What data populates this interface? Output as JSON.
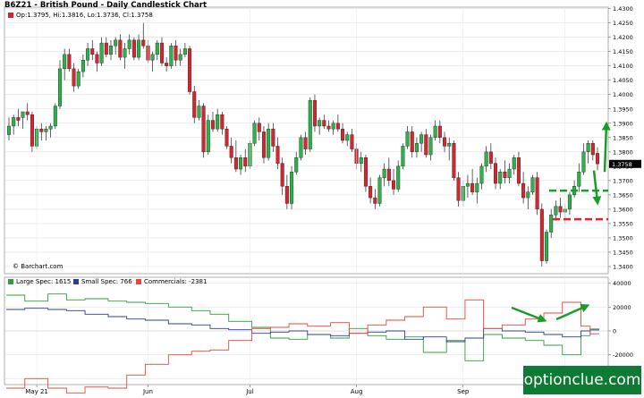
{
  "title": "B6Z21 - British Pound - Daily Candlestick Chart",
  "ohlc_label": "Op:1.3795, Hi:1.3816, Lo:1.3736, Cl:1.3758",
  "copyright": "© Barchart.com",
  "brand": "optionclue.com",
  "last_price_label": "1.3758",
  "colors": {
    "up": "#2bb34a",
    "down": "#d9232d",
    "large_spec": "#2e9d3a",
    "small_spec": "#2b3c9a",
    "commercials": "#e8473a",
    "arrow": "#1a9c2a",
    "dash_green": "#1a9c2a",
    "dash_red": "#d9232d",
    "brand_bg": "#0f7a33"
  },
  "cot_legend": [
    {
      "label": "Large Spec: 1615",
      "color": "#2e9d3a"
    },
    {
      "label": "Small Spec: 766",
      "color": "#2b3c9a"
    },
    {
      "label": "Commercials: -2381",
      "color": "#e8473a"
    }
  ],
  "chart_data": [
    {
      "type": "candlestick",
      "title": "B6Z21 - British Pound - Daily Candlestick Chart",
      "y_ticks": [
        1.34,
        1.345,
        1.35,
        1.355,
        1.36,
        1.365,
        1.37,
        1.375,
        1.38,
        1.385,
        1.39,
        1.395,
        1.4,
        1.405,
        1.41,
        1.415,
        1.42,
        1.425,
        1.43
      ],
      "ylim": [
        1.3375,
        1.4305
      ],
      "x_tick_labels": [
        {
          "label": "May 21",
          "index": 6
        },
        {
          "label": "Jun",
          "index": 30
        },
        {
          "label": "Jul",
          "index": 52
        },
        {
          "label": "Aug",
          "index": 75
        },
        {
          "label": "Sep",
          "index": 98
        },
        {
          "label": "O",
          "index": 120
        }
      ],
      "last_close": 1.3758,
      "candles": [
        [
          1.386,
          1.392,
          1.384,
          1.389
        ],
        [
          1.389,
          1.393,
          1.386,
          1.392
        ],
        [
          1.392,
          1.395,
          1.389,
          1.391
        ],
        [
          1.392,
          1.394,
          1.388,
          1.394
        ],
        [
          1.394,
          1.397,
          1.391,
          1.393
        ],
        [
          1.393,
          1.394,
          1.38,
          1.382
        ],
        [
          1.382,
          1.389,
          1.381,
          1.388
        ],
        [
          1.388,
          1.39,
          1.384,
          1.387
        ],
        [
          1.387,
          1.389,
          1.384,
          1.388
        ],
        [
          1.388,
          1.39,
          1.385,
          1.389
        ],
        [
          1.389,
          1.397,
          1.388,
          1.396
        ],
        [
          1.396,
          1.412,
          1.395,
          1.409
        ],
        [
          1.409,
          1.416,
          1.405,
          1.414
        ],
        [
          1.414,
          1.416,
          1.408,
          1.409
        ],
        [
          1.409,
          1.411,
          1.401,
          1.403
        ],
        [
          1.403,
          1.409,
          1.402,
          1.408
        ],
        [
          1.408,
          1.414,
          1.406,
          1.412
        ],
        [
          1.412,
          1.418,
          1.41,
          1.416
        ],
        [
          1.416,
          1.419,
          1.412,
          1.414
        ],
        [
          1.414,
          1.415,
          1.408,
          1.411
        ],
        [
          1.411,
          1.42,
          1.41,
          1.418
        ],
        [
          1.418,
          1.42,
          1.413,
          1.414
        ],
        [
          1.414,
          1.419,
          1.412,
          1.417
        ],
        [
          1.417,
          1.42,
          1.414,
          1.419
        ],
        [
          1.419,
          1.421,
          1.412,
          1.413
        ],
        [
          1.413,
          1.418,
          1.409,
          1.416
        ],
        [
          1.416,
          1.421,
          1.414,
          1.419
        ],
        [
          1.419,
          1.42,
          1.412,
          1.413
        ],
        [
          1.413,
          1.421,
          1.412,
          1.419
        ],
        [
          1.419,
          1.425,
          1.416,
          1.417
        ],
        [
          1.417,
          1.419,
          1.411,
          1.412
        ],
        [
          1.412,
          1.415,
          1.408,
          1.414
        ],
        [
          1.414,
          1.419,
          1.412,
          1.418
        ],
        [
          1.418,
          1.42,
          1.41,
          1.411
        ],
        [
          1.411,
          1.413,
          1.408,
          1.41
        ],
        [
          1.41,
          1.418,
          1.409,
          1.417
        ],
        [
          1.417,
          1.419,
          1.41,
          1.412
        ],
        [
          1.412,
          1.416,
          1.41,
          1.414
        ],
        [
          1.414,
          1.418,
          1.413,
          1.416
        ],
        [
          1.416,
          1.417,
          1.4,
          1.401
        ],
        [
          1.401,
          1.403,
          1.39,
          1.392
        ],
        [
          1.392,
          1.398,
          1.391,
          1.396
        ],
        [
          1.396,
          1.397,
          1.378,
          1.38
        ],
        [
          1.38,
          1.393,
          1.379,
          1.391
        ],
        [
          1.391,
          1.394,
          1.387,
          1.388
        ],
        [
          1.388,
          1.395,
          1.387,
          1.393
        ],
        [
          1.393,
          1.394,
          1.386,
          1.388
        ],
        [
          1.388,
          1.389,
          1.381,
          1.382
        ],
        [
          1.382,
          1.385,
          1.376,
          1.378
        ],
        [
          1.378,
          1.384,
          1.373,
          1.374
        ],
        [
          1.374,
          1.379,
          1.372,
          1.378
        ],
        [
          1.378,
          1.381,
          1.373,
          1.375
        ],
        [
          1.375,
          1.384,
          1.374,
          1.383
        ],
        [
          1.383,
          1.391,
          1.382,
          1.39
        ],
        [
          1.39,
          1.392,
          1.384,
          1.387
        ],
        [
          1.387,
          1.389,
          1.376,
          1.378
        ],
        [
          1.378,
          1.39,
          1.377,
          1.388
        ],
        [
          1.388,
          1.39,
          1.38,
          1.382
        ],
        [
          1.382,
          1.385,
          1.374,
          1.376
        ],
        [
          1.376,
          1.378,
          1.365,
          1.368
        ],
        [
          1.368,
          1.372,
          1.36,
          1.362
        ],
        [
          1.362,
          1.375,
          1.36,
          1.373
        ],
        [
          1.373,
          1.38,
          1.372,
          1.378
        ],
        [
          1.378,
          1.386,
          1.377,
          1.385
        ],
        [
          1.385,
          1.387,
          1.379,
          1.381
        ],
        [
          1.381,
          1.399,
          1.38,
          1.398
        ],
        [
          1.398,
          1.4,
          1.387,
          1.389
        ],
        [
          1.389,
          1.392,
          1.386,
          1.391
        ],
        [
          1.391,
          1.393,
          1.388,
          1.389
        ],
        [
          1.389,
          1.391,
          1.387,
          1.388
        ],
        [
          1.388,
          1.391,
          1.386,
          1.39
        ],
        [
          1.39,
          1.393,
          1.387,
          1.388
        ],
        [
          1.388,
          1.39,
          1.383,
          1.384
        ],
        [
          1.384,
          1.387,
          1.382,
          1.386
        ],
        [
          1.386,
          1.388,
          1.38,
          1.381
        ],
        [
          1.381,
          1.383,
          1.374,
          1.376
        ],
        [
          1.376,
          1.38,
          1.373,
          1.378
        ],
        [
          1.378,
          1.379,
          1.366,
          1.368
        ],
        [
          1.368,
          1.371,
          1.362,
          1.364
        ],
        [
          1.364,
          1.367,
          1.36,
          1.362
        ],
        [
          1.362,
          1.372,
          1.361,
          1.371
        ],
        [
          1.371,
          1.376,
          1.368,
          1.374
        ],
        [
          1.374,
          1.378,
          1.368,
          1.37
        ],
        [
          1.37,
          1.374,
          1.365,
          1.367
        ],
        [
          1.367,
          1.377,
          1.366,
          1.375
        ],
        [
          1.375,
          1.383,
          1.374,
          1.382
        ],
        [
          1.382,
          1.389,
          1.381,
          1.387
        ],
        [
          1.387,
          1.389,
          1.378,
          1.38
        ],
        [
          1.38,
          1.385,
          1.378,
          1.383
        ],
        [
          1.383,
          1.387,
          1.38,
          1.386
        ],
        [
          1.386,
          1.388,
          1.378,
          1.379
        ],
        [
          1.379,
          1.386,
          1.377,
          1.385
        ],
        [
          1.385,
          1.391,
          1.384,
          1.389
        ],
        [
          1.389,
          1.391,
          1.383,
          1.385
        ],
        [
          1.385,
          1.387,
          1.38,
          1.382
        ],
        [
          1.382,
          1.385,
          1.377,
          1.383
        ],
        [
          1.383,
          1.384,
          1.37,
          1.371
        ],
        [
          1.371,
          1.373,
          1.361,
          1.363
        ],
        [
          1.363,
          1.37,
          1.361,
          1.368
        ],
        [
          1.368,
          1.372,
          1.364,
          1.369
        ],
        [
          1.369,
          1.374,
          1.365,
          1.366
        ],
        [
          1.366,
          1.371,
          1.362,
          1.369
        ],
        [
          1.369,
          1.376,
          1.367,
          1.375
        ],
        [
          1.375,
          1.382,
          1.373,
          1.38
        ],
        [
          1.38,
          1.383,
          1.374,
          1.376
        ],
        [
          1.376,
          1.378,
          1.367,
          1.369
        ],
        [
          1.369,
          1.374,
          1.367,
          1.373
        ],
        [
          1.373,
          1.377,
          1.369,
          1.371
        ],
        [
          1.371,
          1.376,
          1.369,
          1.374
        ],
        [
          1.374,
          1.379,
          1.372,
          1.378
        ],
        [
          1.378,
          1.38,
          1.368,
          1.369
        ],
        [
          1.369,
          1.373,
          1.362,
          1.364
        ],
        [
          1.364,
          1.368,
          1.36,
          1.366
        ],
        [
          1.366,
          1.372,
          1.365,
          1.371
        ],
        [
          1.371,
          1.373,
          1.358,
          1.36
        ],
        [
          1.36,
          1.362,
          1.34,
          1.342
        ],
        [
          1.342,
          1.353,
          1.341,
          1.352
        ],
        [
          1.352,
          1.36,
          1.35,
          1.358
        ],
        [
          1.358,
          1.363,
          1.356,
          1.361
        ],
        [
          1.361,
          1.364,
          1.357,
          1.359
        ],
        [
          1.359,
          1.362,
          1.355,
          1.36
        ],
        [
          1.36,
          1.366,
          1.358,
          1.365
        ],
        [
          1.365,
          1.37,
          1.364,
          1.368
        ],
        [
          1.368,
          1.376,
          1.366,
          1.373
        ],
        [
          1.373,
          1.383,
          1.372,
          1.38
        ],
        [
          1.38,
          1.384,
          1.376,
          1.383
        ],
        [
          1.383,
          1.384,
          1.377,
          1.379
        ],
        [
          1.3795,
          1.3816,
          1.3736,
          1.3758
        ]
      ]
    },
    {
      "type": "line",
      "title": "COT",
      "y_ticks": [
        -40000,
        -20000,
        0,
        20000,
        40000
      ],
      "y_tick_labels": [
        "-40000",
        "-20000",
        "0",
        "20000",
        "40000"
      ],
      "ylim": [
        -45000,
        45000
      ],
      "series": [
        {
          "name": "Large Spec: 1615",
          "color": "#2e9d3a",
          "steps": [
            [
              0,
              30000
            ],
            [
              4,
              25000
            ],
            [
              9,
              31000
            ],
            [
              13,
              26000
            ],
            [
              17,
              27000
            ],
            [
              22,
              25000
            ],
            [
              26,
              24000
            ],
            [
              30,
              23000
            ],
            [
              35,
              20000
            ],
            [
              40,
              17000
            ],
            [
              44,
              14000
            ],
            [
              48,
              8000
            ],
            [
              53,
              3000
            ],
            [
              57,
              -6000
            ],
            [
              61,
              -7000
            ],
            [
              65,
              -3000
            ],
            [
              70,
              -6000
            ],
            [
              74,
              2000
            ],
            [
              78,
              -4000
            ],
            [
              82,
              -7000
            ],
            [
              86,
              -5000
            ],
            [
              90,
              -18000
            ],
            [
              95,
              -8000
            ],
            [
              99,
              -25000
            ],
            [
              103,
              -3000
            ],
            [
              107,
              -6000
            ],
            [
              112,
              -8000
            ],
            [
              116,
              -12000
            ],
            [
              120,
              -20000
            ],
            [
              124,
              -4000
            ],
            [
              126,
              1615
            ]
          ]
        },
        {
          "name": "Small Spec: 766",
          "color": "#2b3c9a",
          "steps": [
            [
              0,
              18000
            ],
            [
              4,
              19000
            ],
            [
              9,
              18000
            ],
            [
              13,
              17000
            ],
            [
              17,
              14000
            ],
            [
              22,
              12000
            ],
            [
              26,
              10000
            ],
            [
              30,
              9000
            ],
            [
              35,
              6000
            ],
            [
              40,
              5000
            ],
            [
              44,
              2000
            ],
            [
              48,
              1000
            ],
            [
              53,
              -2000
            ],
            [
              57,
              -1000
            ],
            [
              61,
              0
            ],
            [
              65,
              -3000
            ],
            [
              70,
              -4000
            ],
            [
              74,
              -2000
            ],
            [
              78,
              -1000
            ],
            [
              82,
              0
            ],
            [
              86,
              -7000
            ],
            [
              90,
              -5000
            ],
            [
              95,
              -9000
            ],
            [
              99,
              -6000
            ],
            [
              103,
              2000
            ],
            [
              107,
              0
            ],
            [
              112,
              -1000
            ],
            [
              116,
              -3000
            ],
            [
              120,
              -5000
            ],
            [
              124,
              0
            ],
            [
              126,
              766
            ]
          ]
        },
        {
          "name": "Commercials: -2381",
          "color": "#e8473a",
          "steps": [
            [
              0,
              -48000
            ],
            [
              4,
              -40000
            ],
            [
              9,
              -48000
            ],
            [
              13,
              -52000
            ],
            [
              17,
              -47000
            ],
            [
              22,
              -48000
            ],
            [
              26,
              -37000
            ],
            [
              30,
              -28000
            ],
            [
              35,
              -20000
            ],
            [
              40,
              -17000
            ],
            [
              44,
              -16000
            ],
            [
              48,
              -8000
            ],
            [
              53,
              2000
            ],
            [
              57,
              3000
            ],
            [
              61,
              6000
            ],
            [
              65,
              4000
            ],
            [
              70,
              7000
            ],
            [
              74,
              -2000
            ],
            [
              78,
              5000
            ],
            [
              82,
              9000
            ],
            [
              86,
              12000
            ],
            [
              90,
              20000
            ],
            [
              95,
              10000
            ],
            [
              99,
              26000
            ],
            [
              103,
              2000
            ],
            [
              107,
              5000
            ],
            [
              112,
              10000
            ],
            [
              116,
              15000
            ],
            [
              120,
              24000
            ],
            [
              124,
              4000
            ],
            [
              126,
              -2381
            ]
          ]
        }
      ]
    }
  ]
}
